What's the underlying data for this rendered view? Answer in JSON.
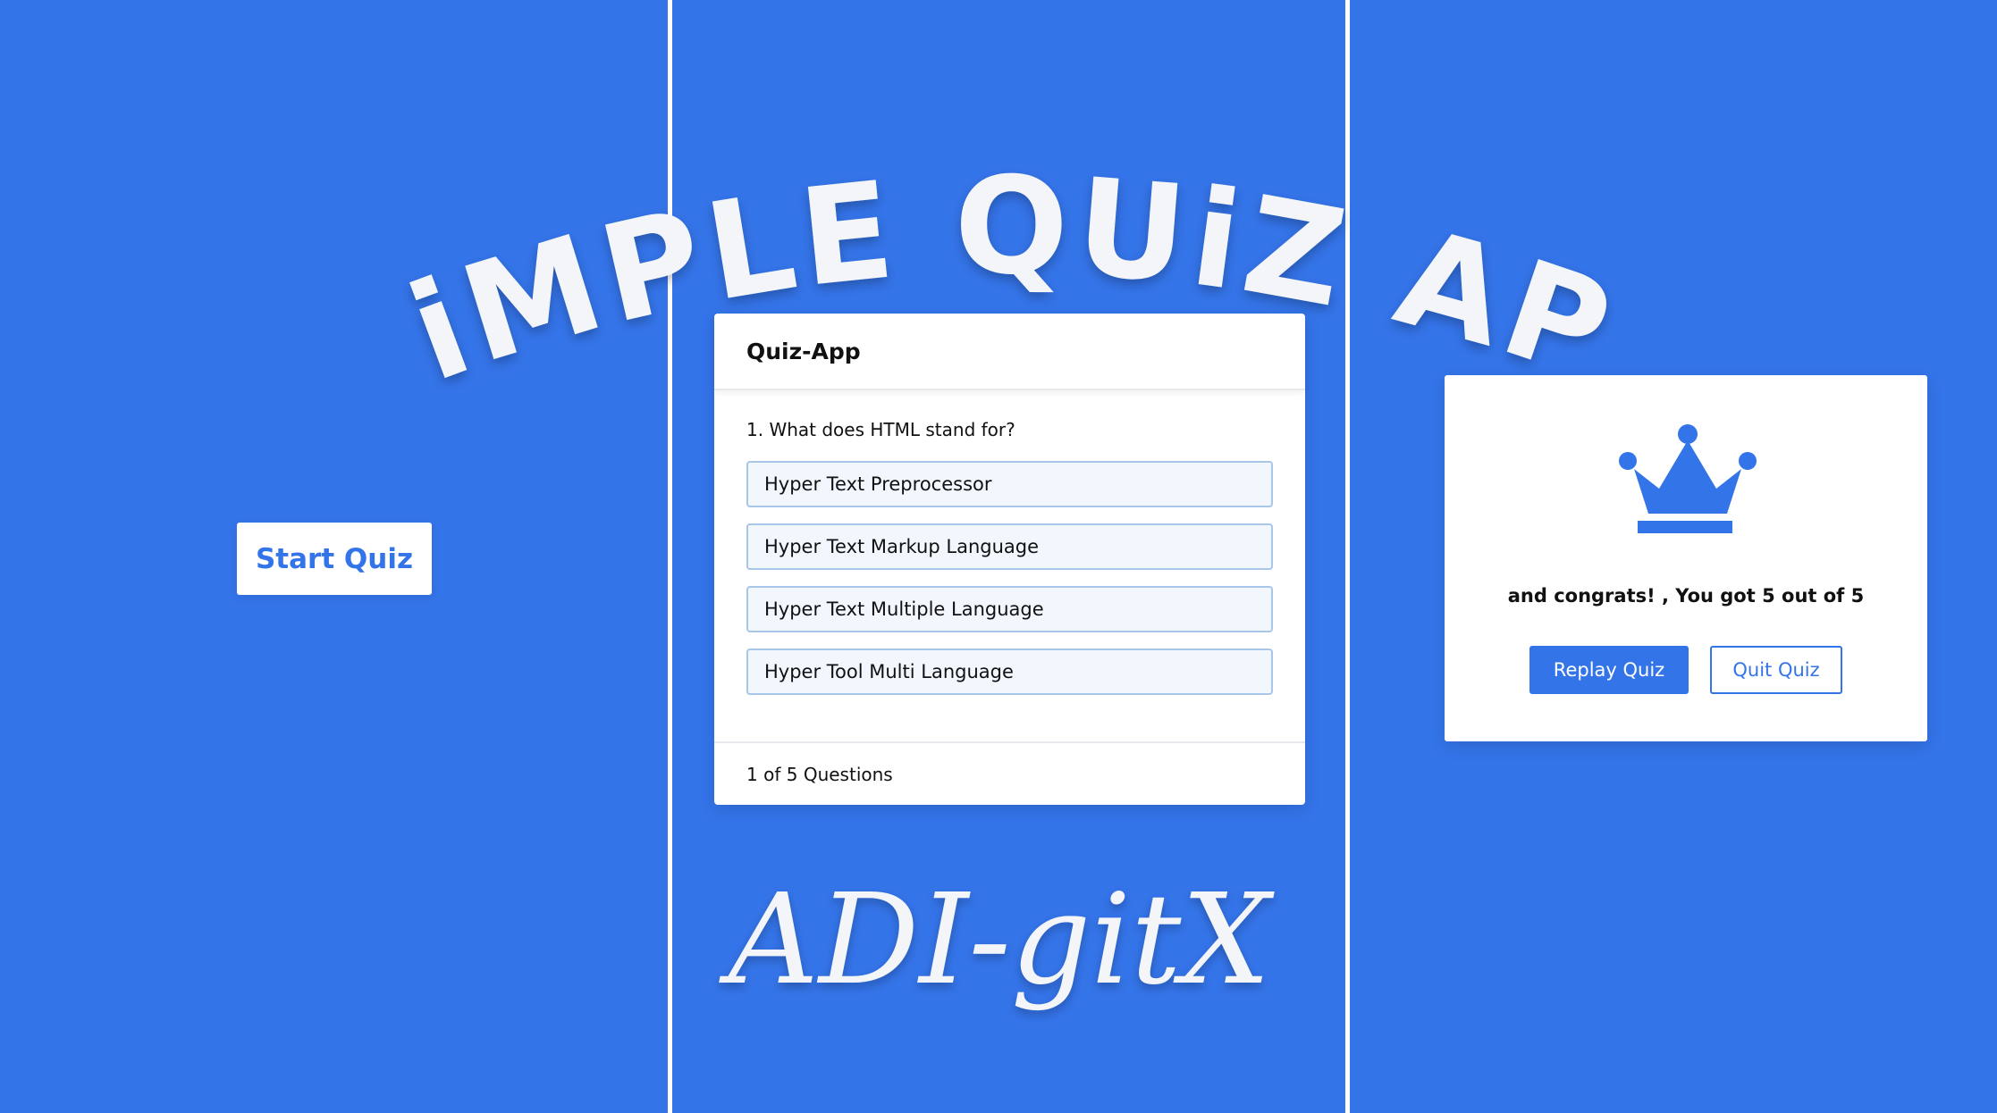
{
  "banner": {
    "title": "SiMPLE QUiZ APP",
    "signature": "ADI-gitX"
  },
  "start_screen": {
    "start_label": "Start Quiz"
  },
  "quiz": {
    "header": "Quiz-App",
    "question": "1. What does HTML stand for?",
    "options": [
      "Hyper Text Preprocessor",
      "Hyper Text Markup Language",
      "Hyper Text Multiple Language",
      "Hyper Tool Multi Language"
    ],
    "progress": {
      "current": "1",
      "of": "of",
      "total": "5",
      "label": "Questions"
    }
  },
  "result": {
    "icon": "crown-icon",
    "text_prefix": "and congrats! , You got",
    "score": "5",
    "out_of": "out of",
    "total": "5",
    "replay_label": "Replay Quiz",
    "quit_label": "Quit Quiz"
  },
  "colors": {
    "background": "#3474e9",
    "accent": "#3474e9",
    "option_bg": "#f1f7fd",
    "option_border": "#a7c6e8",
    "white": "#ffffff"
  }
}
